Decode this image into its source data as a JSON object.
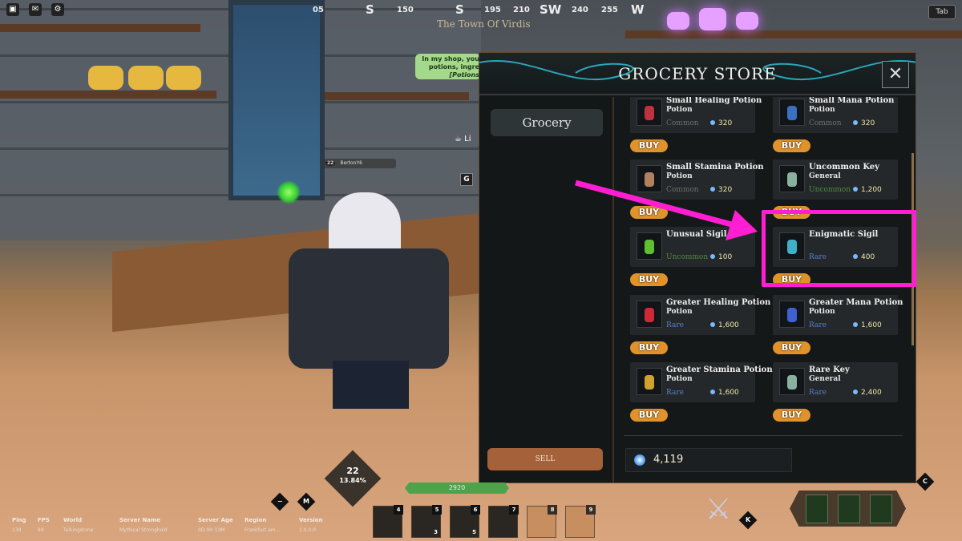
{
  "compass": {
    "marks": [
      "05",
      "S",
      "150",
      "S",
      "195",
      "210",
      "SW",
      "240",
      "255",
      "W"
    ],
    "location": "The Town Of Virdis"
  },
  "hud": {
    "tab_key": "Tab",
    "npc_speech": [
      "In my shop, you",
      "potions, ingre",
      "[Potions"
    ],
    "npc_name": "Li",
    "player_nameplate": {
      "level": "22",
      "name": "BertonY6"
    },
    "interact_key": "G"
  },
  "store": {
    "title": "GROCERY STORE",
    "close_icon": "close-icon",
    "categories": [
      {
        "label": "Grocery",
        "selected": true
      }
    ],
    "sell_label": "SELL",
    "buy_label": "BUY",
    "items": [
      {
        "name": "Small Healing Potion",
        "type": "Potion",
        "rarity": "Common",
        "price": "320",
        "icon": "red-vial-icon"
      },
      {
        "name": "Small Mana Potion",
        "type": "Potion",
        "rarity": "Common",
        "price": "320",
        "icon": "blue-vial-icon"
      },
      {
        "name": "Small Stamina Potion",
        "type": "Potion",
        "rarity": "Common",
        "price": "320",
        "icon": "tan-vial-icon"
      },
      {
        "name": "Uncommon Key",
        "type": "General",
        "rarity": "Uncommon",
        "price": "1,200",
        "icon": "key-icon"
      },
      {
        "name": "Unusual Sigil",
        "type": "",
        "rarity": "Uncommon",
        "price": "100",
        "icon": "green-sigil-icon"
      },
      {
        "name": "Enigmatic Sigil",
        "type": "",
        "rarity": "Rare",
        "price": "400",
        "icon": "blue-sigil-icon",
        "highlighted": true
      },
      {
        "name": "Greater Healing Potion",
        "type": "Potion",
        "rarity": "Rare",
        "price": "1,600",
        "icon": "red-potion-icon"
      },
      {
        "name": "Greater Mana Potion",
        "type": "Potion",
        "rarity": "Rare",
        "price": "1,600",
        "icon": "blue-potion-icon"
      },
      {
        "name": "Greater Stamina Potion",
        "type": "Potion",
        "rarity": "Rare",
        "price": "1,600",
        "icon": "yellow-potion-icon"
      },
      {
        "name": "Rare Key",
        "type": "General",
        "rarity": "Rare",
        "price": "2,400",
        "icon": "key-icon"
      }
    ],
    "currency": "4,119",
    "rarity_colors": {
      "Common": "#6e6e6e",
      "Uncommon": "#4f8a3e",
      "Rare": "#5a7fc8"
    },
    "highlight_color": "#ff1ed2"
  },
  "player": {
    "level": "22",
    "xp_percent": "13.84%",
    "health": "2920"
  },
  "hotbar": [
    {
      "key": "4",
      "qty": ""
    },
    {
      "key": "5",
      "qty": "3"
    },
    {
      "key": "6",
      "qty": "5"
    },
    {
      "key": "7",
      "qty": ""
    },
    {
      "key": "8",
      "qty": ""
    },
    {
      "key": "9",
      "qty": ""
    }
  ],
  "keys": {
    "menu": "M",
    "inventory": "K",
    "character": "C"
  },
  "stats": {
    "labels": [
      "Ping",
      "FPS",
      "World",
      "Server Name",
      "Server Age",
      "Region",
      "Version"
    ],
    "values": [
      "139",
      "94",
      "Talkingstone",
      "Mythical Stronghold",
      "0D 0H 13M",
      "Frankfurt am...",
      "1.0.0.0"
    ]
  }
}
